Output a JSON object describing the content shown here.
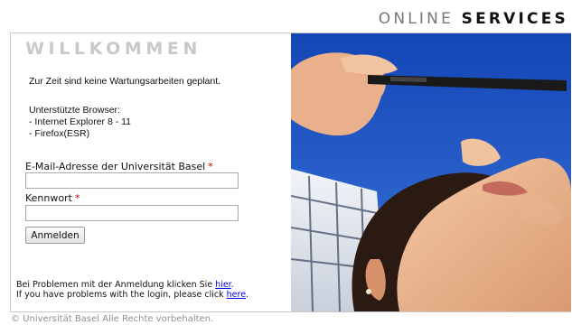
{
  "header": {
    "title_light": "ONLINE",
    "title_bold": "SERVICES"
  },
  "login": {
    "welcome": "WILLKOMMEN",
    "maintenance_notice": "Zur Zeit sind keine Wartungsarbeiten geplant.",
    "browsers_title": "Unterstützte Browser:",
    "browsers": [
      "- Internet Explorer 8 - 11",
      "- Firefox(ESR)"
    ],
    "email_label": "E-Mail-Adresse der Universität Basel",
    "email_value": "",
    "password_label": "Kennwort",
    "password_value": "",
    "required_marker": "*",
    "submit_label": "Anmelden"
  },
  "help": {
    "de_text": "Bei Problemen mit der Anmeldung klicken Sie ",
    "de_link": "hier",
    "de_end": ".",
    "en_text": "If you have problems with the login, please click ",
    "en_link": "here",
    "en_end": "."
  },
  "footer": {
    "copyright": "© Universität Basel Alle Rechte vorbehalten."
  },
  "colors": {
    "accent_link": "#0000ee",
    "required": "#c00000",
    "welcome": "#c9c9c9",
    "sky": "#1f55c4"
  }
}
